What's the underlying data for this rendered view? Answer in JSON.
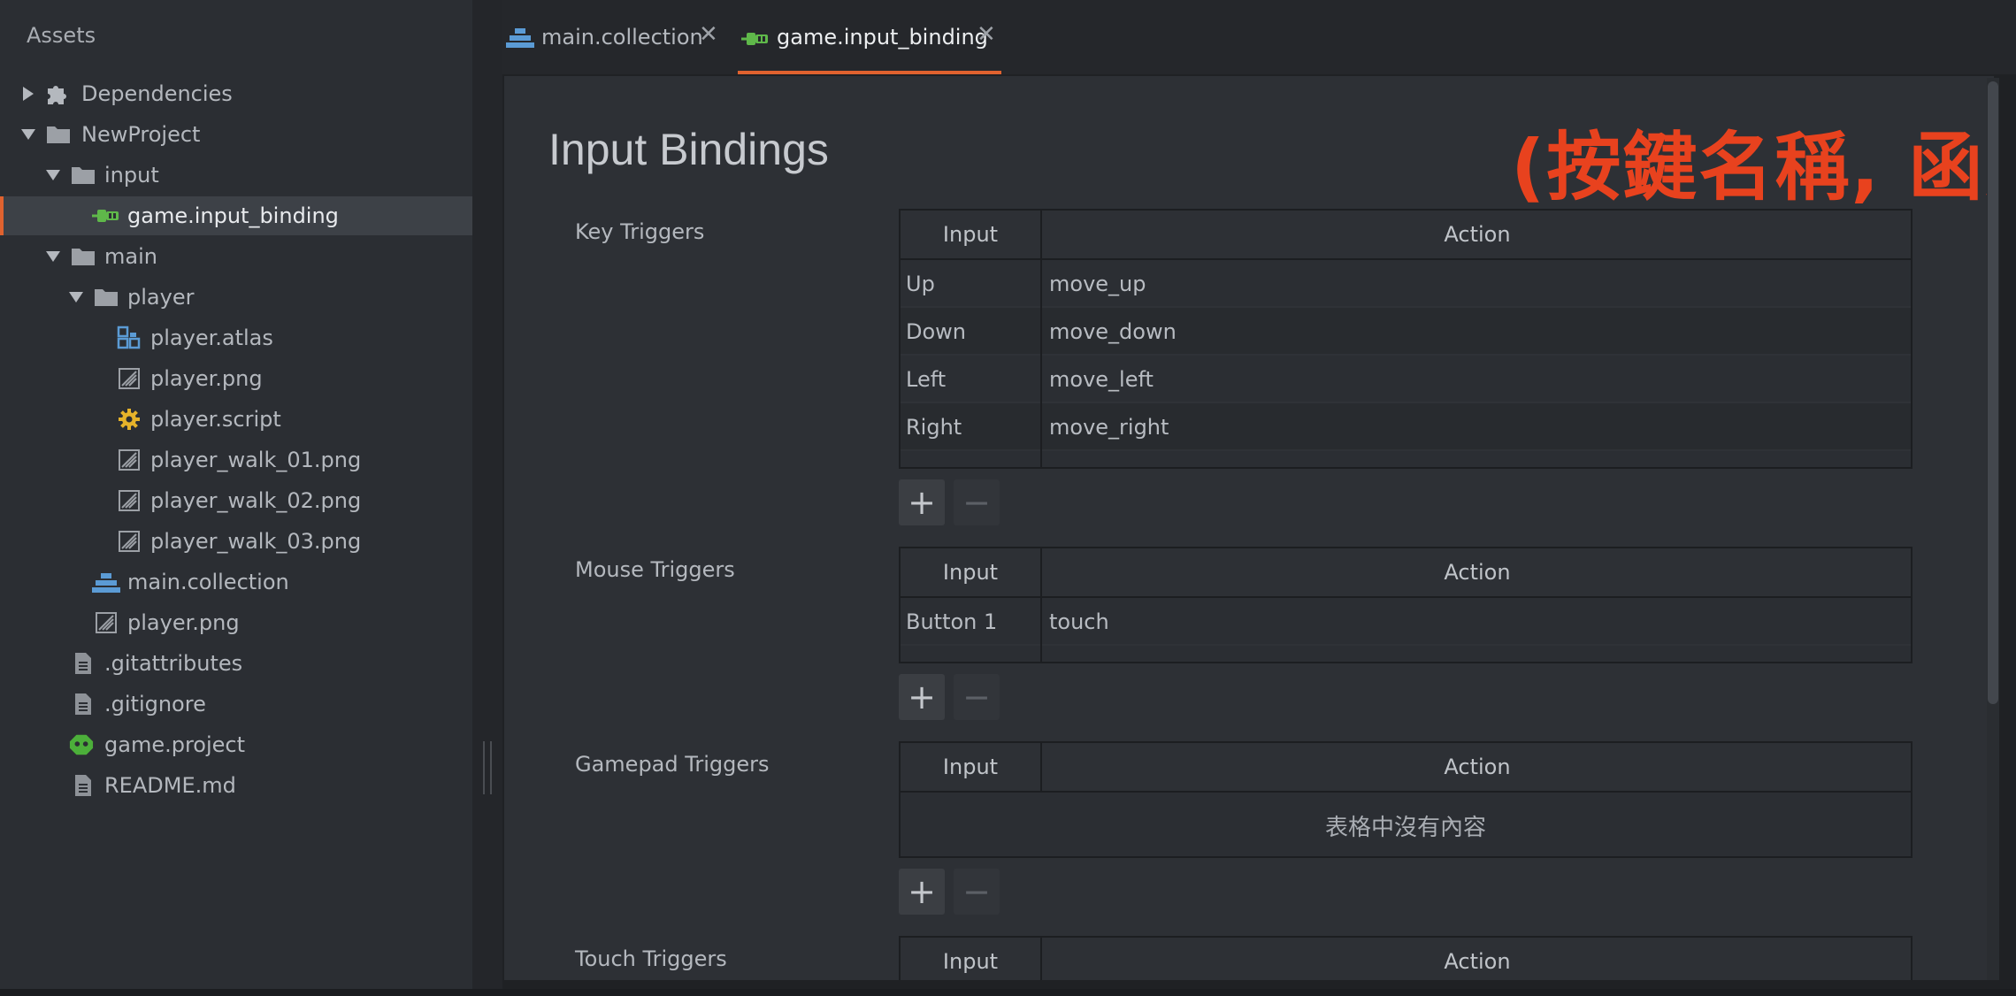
{
  "assets": {
    "title": "Assets",
    "items": [
      {
        "label": "Dependencies"
      },
      {
        "label": "NewProject"
      },
      {
        "label": "input"
      },
      {
        "label": "game.input_binding"
      },
      {
        "label": "main"
      },
      {
        "label": "player"
      },
      {
        "label": "player.atlas"
      },
      {
        "label": "player.png"
      },
      {
        "label": "player.script"
      },
      {
        "label": "player_walk_01.png"
      },
      {
        "label": "player_walk_02.png"
      },
      {
        "label": "player_walk_03.png"
      },
      {
        "label": "main.collection"
      },
      {
        "label": "player.png"
      },
      {
        "label": ".gitattributes"
      },
      {
        "label": ".gitignore"
      },
      {
        "label": "game.project"
      },
      {
        "label": "README.md"
      }
    ]
  },
  "tabs": [
    {
      "label": "main.collection",
      "close": "✕"
    },
    {
      "label": "game.input_binding",
      "close": "✕"
    }
  ],
  "editor": {
    "title": "Input Bindings",
    "annotation": "(按鍵名稱, 函數名稱)",
    "columns": {
      "input": "Input",
      "action": "Action"
    },
    "add_symbol": "+",
    "remove_symbol": "−",
    "key_triggers": {
      "label": "Key Triggers",
      "rows": [
        {
          "input": "Up",
          "action": "move_up"
        },
        {
          "input": "Down",
          "action": "move_down"
        },
        {
          "input": "Left",
          "action": "move_left"
        },
        {
          "input": "Right",
          "action": "move_right"
        }
      ]
    },
    "mouse_triggers": {
      "label": "Mouse Triggers",
      "rows": [
        {
          "input": "Button 1",
          "action": "touch"
        }
      ]
    },
    "gamepad_triggers": {
      "label": "Gamepad Triggers",
      "empty_text": "表格中沒有內容"
    },
    "touch_triggers": {
      "label": "Touch Triggers"
    }
  },
  "colors": {
    "accent": "#e0622f",
    "annotation": "#e8421e",
    "collection_icon": "#5b9bd5",
    "binding_icon": "#5fb84a",
    "script_icon": "#e6b32a",
    "project_icon": "#4caf3a"
  }
}
